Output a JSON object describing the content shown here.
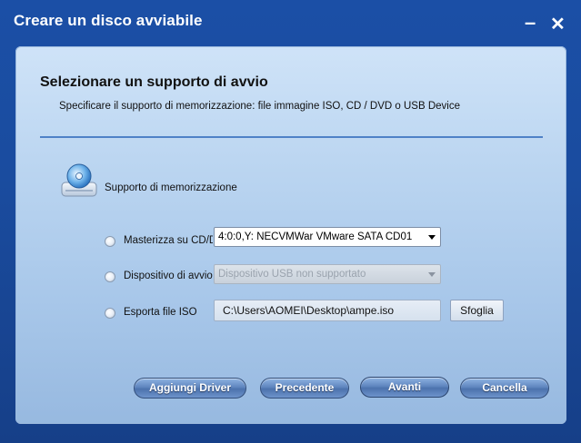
{
  "window": {
    "title": "Creare un disco avviabile",
    "minimize_glyph": "–",
    "close_glyph": "✕"
  },
  "header": {
    "heading": "Selezionare un supporto di avvio",
    "subtext": "Specificare il supporto di memorizzazione: file immagine ISO, CD / DVD o USB Device"
  },
  "media": {
    "icon": "optical-disk-icon",
    "label": "Supporto di memorizzazione"
  },
  "options": [
    {
      "label": "Masterizza su CD/DVD",
      "control_value": "4:0:0,Y: NECVMWar VMware SATA CD01",
      "enabled": true
    },
    {
      "label": "Dispositivo di avvio USB",
      "control_value": "Dispositivo USB non supportato",
      "enabled": false
    },
    {
      "label": "Esporta file ISO",
      "control_value": "C:\\Users\\AOMEI\\Desktop\\ampe.iso",
      "browse_label": "Sfoglia"
    }
  ],
  "buttons": {
    "add_driver": "Aggiungi Driver",
    "previous": "Precedente",
    "next": "Avanti",
    "cancel": "Cancella"
  },
  "colors": {
    "frame": "#1b4fa6",
    "panel": "#bcd6f1",
    "divider": "#4f81c7",
    "button": "#5f86bf"
  }
}
